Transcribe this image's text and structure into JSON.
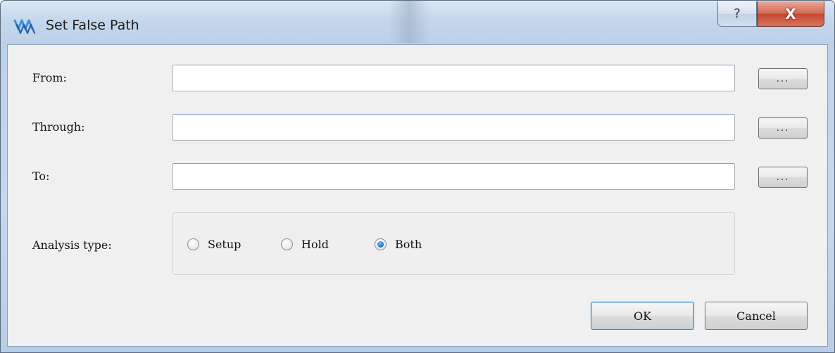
{
  "window": {
    "title": "Set False Path",
    "help_label": "?",
    "close_label": "X",
    "icon": "app-logo-icon"
  },
  "form": {
    "from_label": "From:",
    "through_label": "Through:",
    "to_label": "To:",
    "from_value": "",
    "through_value": "",
    "to_value": "",
    "browse_label": "...",
    "analysis_type_label": "Analysis type:",
    "analysis_options": [
      "Setup",
      "Hold",
      "Both"
    ],
    "analysis_selected": "Both"
  },
  "buttons": {
    "ok_label": "OK",
    "cancel_label": "Cancel"
  },
  "colors": {
    "accent": "#3c7fb1",
    "close_red": "#c24a31",
    "radio_checked": "#2a7ccc"
  }
}
